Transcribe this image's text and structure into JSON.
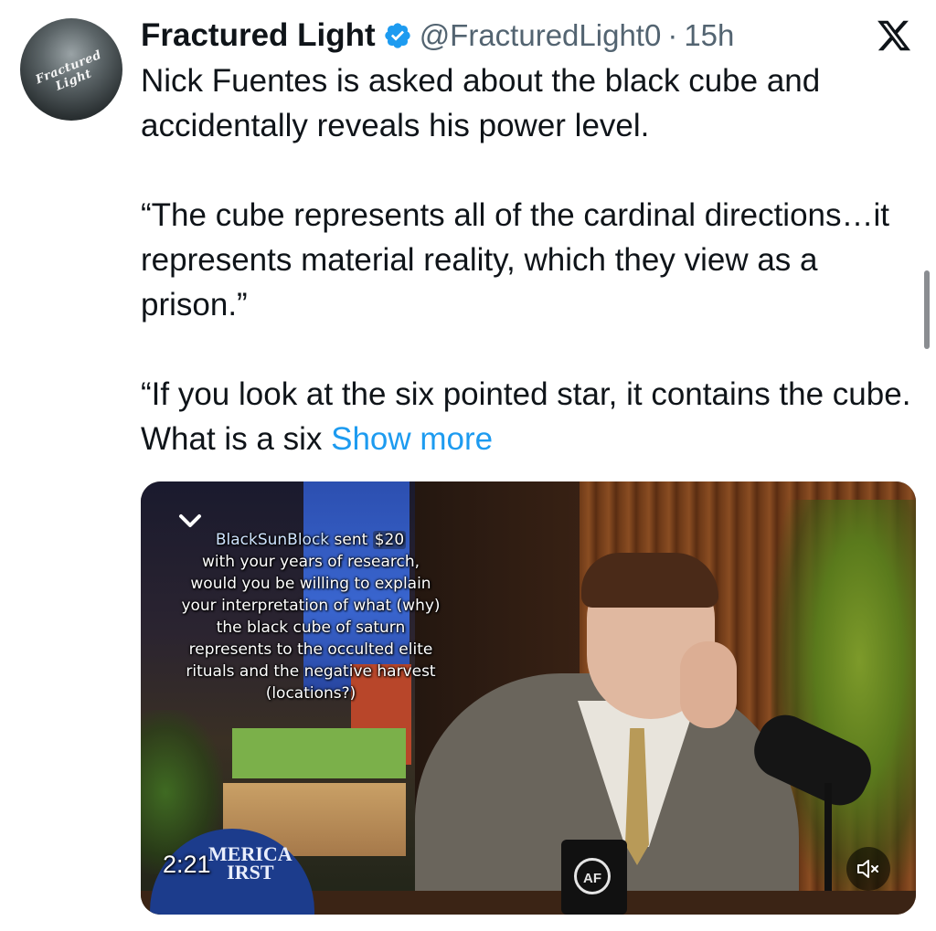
{
  "tweet": {
    "display_name": "Fractured Light",
    "handle": "@FracturedLight0",
    "separator": "·",
    "time": "15h",
    "verified_icon": "verified-badge-icon",
    "avatar_text": "Fractured Light",
    "paragraphs": [
      "Nick Fuentes is asked about the black cube and accidentally reveals his power level.",
      "“The cube represents all of the cardinal directions…it represents material reality, which they view as a prison.”",
      "“If you look at the six pointed star, it contains the cube. What is a six"
    ],
    "show_more": "Show more"
  },
  "platform": {
    "logo_icon": "x-logo-icon"
  },
  "media": {
    "type": "video",
    "duration": "2:21",
    "overlay": {
      "sender": "BlackSunBlock",
      "sent_text": "sent",
      "amount": "$20",
      "lines": [
        "with your years of research,",
        "would you be willing to explain",
        "your interpretation of what (why)",
        "the black cube of saturn",
        "represents to the occulted elite",
        "rituals and the negative harvest",
        "(locations?)"
      ]
    },
    "hat_text_line1": "MERICA",
    "hat_text_line2": "IRST",
    "mug_text": "AF",
    "mute_icon": "speaker-muted-icon",
    "chevron_icon": "chevron-down-icon"
  },
  "colors": {
    "text_primary": "#0f1419",
    "text_secondary": "#536471",
    "link": "#1d9bf0",
    "verified": "#1d9bf0"
  }
}
